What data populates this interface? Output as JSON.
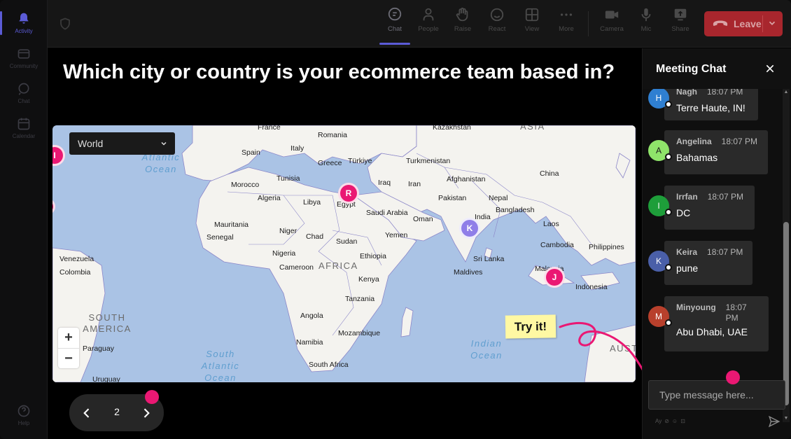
{
  "rail": {
    "items": [
      {
        "label": "Activity",
        "icon": "bell-icon",
        "active": true
      },
      {
        "label": "Community",
        "icon": "community-icon",
        "active": false
      },
      {
        "label": "Chat",
        "icon": "chat-icon",
        "active": false
      },
      {
        "label": "Calendar",
        "icon": "calendar-icon",
        "active": false
      }
    ],
    "help": "Help"
  },
  "toolbar": {
    "chat": "Chat",
    "people": "People",
    "raise": "Raise",
    "react": "React",
    "view": "View",
    "more": "More",
    "camera": "Camera",
    "mic": "Mic",
    "share": "Share",
    "leave": "Leave"
  },
  "main": {
    "question": "Which city or country is your ecommerce team based in?",
    "region_select": "World",
    "zoom_in": "+",
    "zoom_out": "−",
    "try_it": "Try it!",
    "page_number": "2"
  },
  "map": {
    "labels": {
      "france": "France",
      "romania": "Romania",
      "kazakhstan": "Kazakhstan",
      "asia": "ASIA",
      "spain": "Spain",
      "italy": "Italy",
      "greece": "Greece",
      "turkiye": "Türkiye",
      "turkmenistan": "Turkmenistan",
      "china": "China",
      "tunisia": "Tunisia",
      "morocco": "Morocco",
      "iraq": "Iraq",
      "iran": "Iran",
      "afghanistan": "Afghanistan",
      "algeria": "Algeria",
      "libya": "Libya",
      "egypt": "Egypt",
      "nepal": "Nepal",
      "pakistan": "Pakistan",
      "bangladesh": "Bangladesh",
      "saudi": "Saudi Arabia",
      "india": "India",
      "oman": "Oman",
      "mauritania": "Mauritania",
      "niger": "Niger",
      "chad": "Chad",
      "sudan": "Sudan",
      "yemen": "Yemen",
      "laos": "Laos",
      "senegal": "Senegal",
      "nigeria": "Nigeria",
      "cambodia": "Cambodia",
      "philippines": "Philippines",
      "venezuela": "Venezuela",
      "ethiopia": "Ethiopia",
      "srilanka": "Sri Lanka",
      "cameroon": "Cameroon",
      "africa": "AFRICA",
      "colombia": "Colombia",
      "maldives": "Maldives",
      "malaysia": "Malaysia",
      "kenya": "Kenya",
      "indonesia": "Indonesia",
      "tanzania": "Tanzania",
      "southamerica": "SOUTH AMERICA",
      "angola": "Angola",
      "mozambique": "Mozambique",
      "namibia": "Namibia",
      "paraguay": "Paraguay",
      "southafrica": "South Africa",
      "uruguay": "Uruguay",
      "atlantic": "Atlantic Ocean",
      "southatlantic": "South Atlantic Ocean",
      "indian": "Indian Ocean",
      "australia": "AUST"
    },
    "pins": [
      {
        "letter": "R",
        "color": "#ea1873"
      },
      {
        "letter": "K",
        "color": "#8f7ee8"
      },
      {
        "letter": "J",
        "color": "#ea1873"
      },
      {
        "letter": "I",
        "color": "#ea1873"
      }
    ]
  },
  "chat": {
    "title": "Meeting Chat",
    "messages": [
      {
        "initial": "H",
        "name": "Nagh",
        "time": "18:07 PM",
        "text": "Terre Haute, IN!",
        "avatar_color": "#2f7fd1"
      },
      {
        "initial": "A",
        "name": "Angelina",
        "time": "18:07 PM",
        "text": "Bahamas",
        "avatar_color": "#8fe46a"
      },
      {
        "initial": "I",
        "name": "Irrfan",
        "time": "18:07 PM",
        "text": "DC",
        "avatar_color": "#1e9e3a"
      },
      {
        "initial": "K",
        "name": "Keira",
        "time": "18:07 PM",
        "text": "pune",
        "avatar_color": "#4a5fa8"
      },
      {
        "initial": "M",
        "name": "Minyoung",
        "time": "18:07 PM",
        "text": "Abu Dhabi, UAE",
        "avatar_color": "#b8402c"
      }
    ],
    "input_placeholder": "Type message here..."
  }
}
